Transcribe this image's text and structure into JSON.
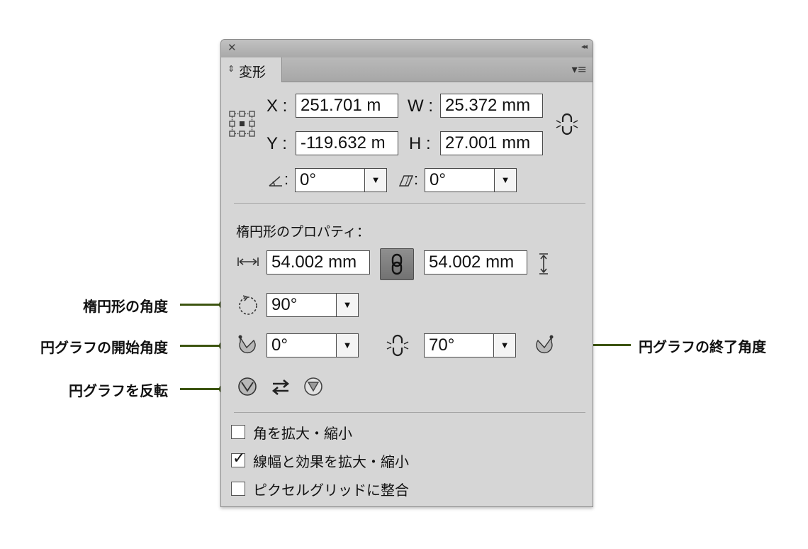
{
  "panel": {
    "close_glyph": "✕",
    "collapse_glyph": "◂◂",
    "tab_label": "変形",
    "tab_arrows": "⇕",
    "menu_glyph": "▾≡"
  },
  "transform": {
    "x_label": "X :",
    "x_value": "251.701 m",
    "w_label": "W :",
    "w_value": "25.372 mm",
    "y_label": "Y :",
    "y_value": "-119.632 m",
    "h_label": "H :",
    "h_value": "27.001 mm",
    "rotate_value": "0°",
    "shear_value": "0°",
    "angle_colon": ":"
  },
  "ellipse": {
    "section_title": "楕円形のプロパティ：",
    "width_value": "54.002 mm",
    "height_value": "54.002 mm",
    "angle_value": "90°",
    "pie_start_value": "0°",
    "pie_end_value": "70°"
  },
  "options": {
    "scale_corners": "角を拡大・縮小",
    "scale_corners_checked": false,
    "scale_strokes": "線幅と効果を拡大・縮小",
    "scale_strokes_checked": true,
    "align_pixel": "ピクセルグリッドに整合",
    "align_pixel_checked": false
  },
  "callouts": {
    "ellipse_angle": "楕円形の角度",
    "pie_start": "円グラフの開始角度",
    "pie_invert": "円グラフを反転",
    "pie_end": "円グラフの終了角度"
  },
  "colors": {
    "callout_accent": "#3c5410",
    "panel_bg": "#d6d6d6"
  }
}
